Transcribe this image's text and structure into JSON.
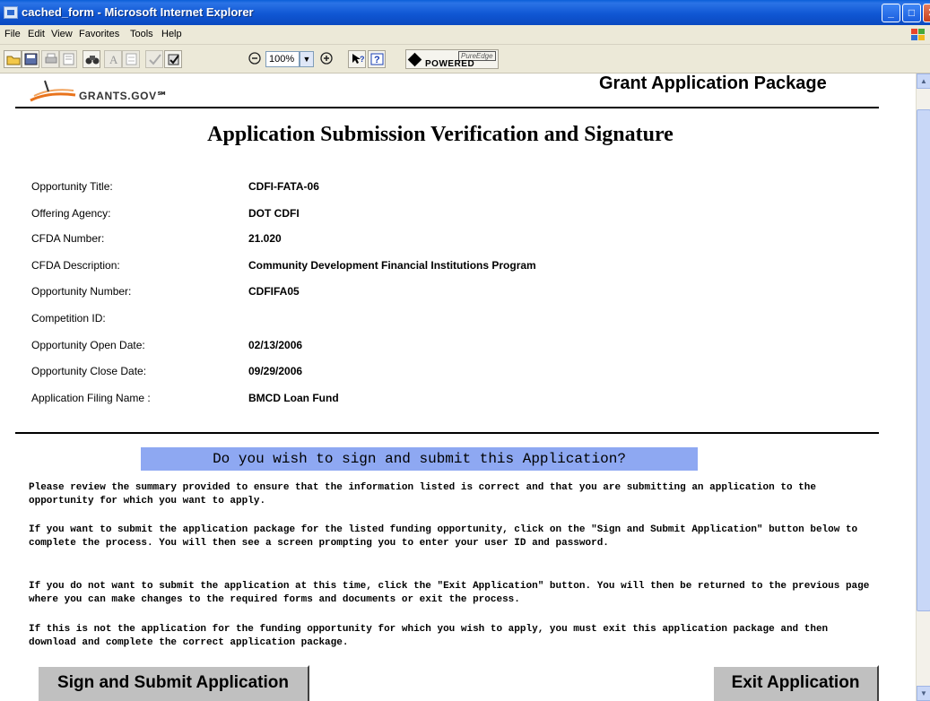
{
  "window": {
    "title": "cached_form - Microsoft Internet Explorer",
    "min_glyph": "_",
    "max_glyph": "□",
    "close_glyph": "✕"
  },
  "menu": [
    "File",
    "Edit",
    "View",
    "Favorites",
    "Tools",
    "Help"
  ],
  "toolbar": {
    "zoom": "100%",
    "zoom_dropdown_glyph": "▼",
    "pureedge_top": "PureEdge",
    "pureedge_bottom": "POWERED"
  },
  "header": {
    "logo_text": "GRANTS.GOV℠",
    "package_title": "Grant Application Package"
  },
  "page_title": "Application Submission Verification and Signature",
  "fields": [
    {
      "label": "Opportunity Title:",
      "value": "CDFI-FATA-06"
    },
    {
      "label": "Offering Agency:",
      "value": "DOT CDFI"
    },
    {
      "label": "CFDA Number:",
      "value": "21.020"
    },
    {
      "label": "CFDA Description:",
      "value": "Community Development Financial Institutions Program"
    },
    {
      "label": "Opportunity Number:",
      "value": "CDFIFA05"
    },
    {
      "label": "Competition ID:",
      "value": ""
    },
    {
      "label": "Opportunity Open Date:",
      "value": "02/13/2006"
    },
    {
      "label": "Opportunity Close Date:",
      "value": "09/29/2006"
    },
    {
      "label": "Application Filing Name :",
      "value": "BMCD Loan Fund"
    }
  ],
  "question": "Do you wish to sign and submit this Application?",
  "paragraphs": [
    "Please review the summary provided to ensure that the information listed is correct and that you are submitting an application to the opportunity for which you want to apply.",
    "If you want to submit the application package for the listed funding opportunity, click on the \"Sign and Submit Application\" button below to complete the process. You will then see a screen prompting you to enter your user ID and password.",
    "If you do not want to submit the application at this time, click the \"Exit Application\" button. You will then be returned to the previous page where you can make changes to the required forms and documents or exit the process.",
    "If this is not the application for the funding opportunity for which you wish to apply, you must exit this application package and then download and complete the correct application package."
  ],
  "buttons": {
    "sign_submit": "Sign and Submit Application",
    "exit": "Exit Application"
  },
  "icons": [
    "app-icon",
    "open-folder-icon",
    "save-icon",
    "print-icon",
    "print-preview-icon",
    "binoculars-icon",
    "text-icon",
    "form-icon",
    "spellcheck-icon",
    "paste-icon",
    "zoom-out-icon",
    "zoom-in-icon",
    "help-pointer-icon",
    "help-icon",
    "pureedge-logo-icon",
    "windows-logo-icon"
  ],
  "colors": {
    "title_bar": "#1057d4",
    "question_band": "#8ea8f2",
    "button_face": "#c0c0c0",
    "logo_orange": "#e8731c"
  }
}
